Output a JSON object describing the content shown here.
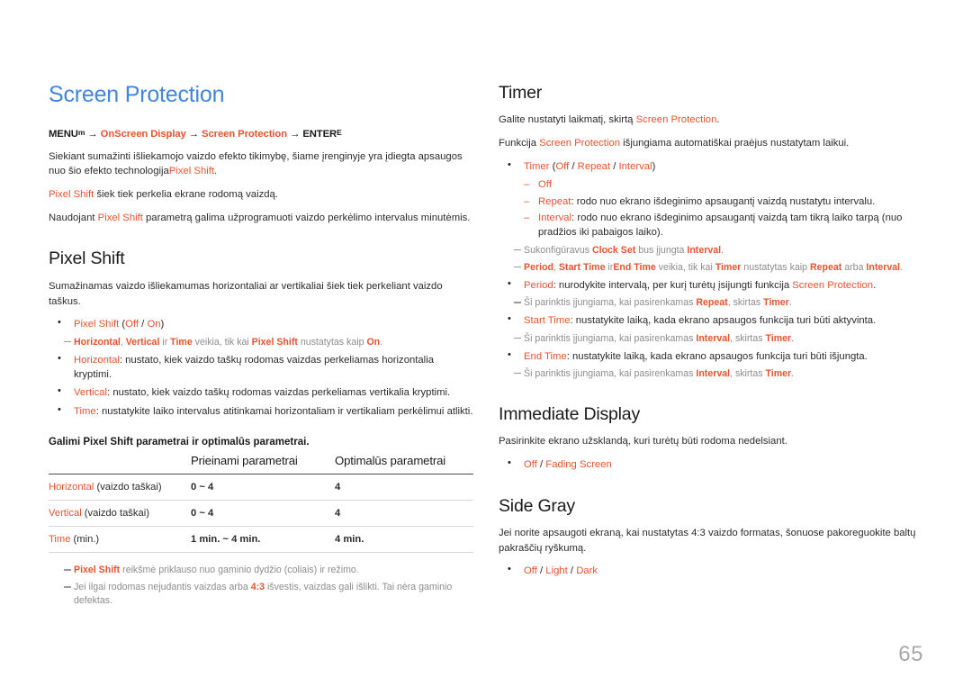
{
  "page": {
    "number": "65",
    "title": "Screen Protection",
    "title_color": "#4185dd",
    "accent_color": "#e8522e",
    "note_color": "#8c8c8c"
  },
  "left": {
    "menu_path": {
      "prefix": "MENU",
      "prefix_sup": "m",
      "arrow1": "→",
      "item1": "OnScreen Display",
      "arrow2": "→",
      "item2": "Screen Protection",
      "arrow3": "→",
      "suffix": "ENTER",
      "suffix_sup": "E"
    },
    "intro": [
      {
        "segments": [
          {
            "t": "Siekiant sumažinti išliekamojo vaizdo efekto tikimybę, šiame įrenginyje yra įdiegta apsaugos nuo šio efekto technologija",
            "s": "plain"
          },
          {
            "t": "Pixel Shift",
            "s": "orange"
          },
          {
            "t": ".",
            "s": "plain"
          }
        ]
      },
      {
        "segments": [
          {
            "t": "Pixel Shift",
            "s": "orange"
          },
          {
            "t": " šiek tiek perkelia ekrane rodomą vaizdą.",
            "s": "plain"
          }
        ]
      },
      {
        "segments": [
          {
            "t": "Naudojant ",
            "s": "plain"
          },
          {
            "t": "Pixel Shift",
            "s": "orange"
          },
          {
            "t": " parametrą galima užprogramuoti vaizdo perkėlimo intervalus minutėmis.",
            "s": "plain"
          }
        ]
      }
    ],
    "pixel_shift": {
      "heading": "Pixel Shift",
      "desc": "Sumažinamas vaizdo išliekamumas horizontaliai ar vertikaliai šiek tiek perkeliant vaizdo taškus.",
      "items": [
        {
          "type": "bullet",
          "segments": [
            {
              "t": "Pixel Shift",
              "s": "orange"
            },
            {
              "t": " (",
              "s": "plain"
            },
            {
              "t": "Off",
              "s": "orange"
            },
            {
              "t": " / ",
              "s": "plain"
            },
            {
              "t": "On",
              "s": "orange"
            },
            {
              "t": ")",
              "s": "plain"
            }
          ]
        },
        {
          "type": "note",
          "segments": [
            {
              "t": "Horizontal",
              "s": "orange-b"
            },
            {
              "t": ", ",
              "s": "gray"
            },
            {
              "t": "Vertical",
              "s": "orange-b"
            },
            {
              "t": " ir ",
              "s": "gray"
            },
            {
              "t": "Time",
              "s": "orange-b"
            },
            {
              "t": " veikia, tik kai ",
              "s": "gray"
            },
            {
              "t": "Pixel Shift",
              "s": "orange-b"
            },
            {
              "t": " nustatytas kaip ",
              "s": "gray"
            },
            {
              "t": "On",
              "s": "orange-b"
            },
            {
              "t": ".",
              "s": "gray"
            }
          ]
        },
        {
          "type": "bullet",
          "segments": [
            {
              "t": "Horizontal",
              "s": "orange"
            },
            {
              "t": ": nustato, kiek vaizdo taškų rodomas vaizdas perkeliamas horizontalia kryptimi.",
              "s": "plain"
            }
          ]
        },
        {
          "type": "bullet",
          "segments": [
            {
              "t": "Vertical",
              "s": "orange"
            },
            {
              "t": ": nustato, kiek vaizdo taškų rodomas vaizdas perkeliamas vertikalia kryptimi.",
              "s": "plain"
            }
          ]
        },
        {
          "type": "bullet",
          "segments": [
            {
              "t": "Time",
              "s": "orange"
            },
            {
              "t": ": nustatykite laiko intervalus atitinkamai horizontaliam ir vertikaliam perkėlimui atlikti.",
              "s": "plain"
            }
          ]
        }
      ]
    },
    "table": {
      "caption": "Galimi Pixel Shift parametrai ir optimalūs parametrai.",
      "headers": [
        "",
        "Prieinami parametrai",
        "Optimalūs parametrai"
      ],
      "rows": [
        {
          "label": "Horizontal",
          "label_suffix": " (vaizdo taškai)",
          "available": "0 ~ 4",
          "optimal": "4"
        },
        {
          "label": "Vertical",
          "label_suffix": " (vaizdo taškai)",
          "available": "0 ~ 4",
          "optimal": "4"
        },
        {
          "label": "Time",
          "label_suffix": " (min.)",
          "available": "1 min. ~ 4 min.",
          "optimal": "4 min."
        }
      ]
    },
    "table_notes": [
      {
        "segments": [
          {
            "t": "Pixel Shift",
            "s": "orange-b"
          },
          {
            "t": " reikšmė priklauso nuo gaminio dydžio (coliais) ir režimo.",
            "s": "gray"
          }
        ]
      },
      {
        "segments": [
          {
            "t": "Jei ilgai rodomas nejudantis vaizdas arba ",
            "s": "gray"
          },
          {
            "t": "4:3",
            "s": "orange-b"
          },
          {
            "t": " išvestis, vaizdas gali išlikti. Tai nėra gaminio defektas.",
            "s": "gray"
          }
        ]
      }
    ]
  },
  "right": {
    "timer": {
      "heading": "Timer",
      "paras": [
        {
          "segments": [
            {
              "t": "Galite nustatyti laikmatį, skirtą ",
              "s": "plain"
            },
            {
              "t": "Screen Protection",
              "s": "orange"
            },
            {
              "t": ".",
              "s": "plain"
            }
          ]
        },
        {
          "segments": [
            {
              "t": "Funkcija ",
              "s": "plain"
            },
            {
              "t": "Screen Protection",
              "s": "orange"
            },
            {
              "t": " išjungiama automatiškai praėjus nustatytam laikui.",
              "s": "plain"
            }
          ]
        }
      ],
      "items": [
        {
          "type": "bullet",
          "segments": [
            {
              "t": "Timer",
              "s": "orange"
            },
            {
              "t": " (",
              "s": "plain"
            },
            {
              "t": "Off",
              "s": "orange"
            },
            {
              "t": " / ",
              "s": "plain"
            },
            {
              "t": "Repeat",
              "s": "orange"
            },
            {
              "t": " / ",
              "s": "plain"
            },
            {
              "t": "Interval",
              "s": "orange"
            },
            {
              "t": ")",
              "s": "plain"
            }
          ]
        },
        {
          "type": "dash",
          "segments": [
            {
              "t": "Off",
              "s": "orange"
            }
          ]
        },
        {
          "type": "dash",
          "segments": [
            {
              "t": "Repeat",
              "s": "orange"
            },
            {
              "t": ": rodo nuo ekrano išdeginimo apsaugantį vaizdą nustatytu intervalu.",
              "s": "plain"
            }
          ]
        },
        {
          "type": "dash",
          "segments": [
            {
              "t": "Interval",
              "s": "orange"
            },
            {
              "t": ": rodo nuo ekrano išdeginimo apsaugantį vaizdą tam tikrą laiko tarpą (nuo pradžios iki pabaigos laiko).",
              "s": "plain"
            }
          ]
        },
        {
          "type": "note",
          "segments": [
            {
              "t": "Sukonfigūravus ",
              "s": "gray"
            },
            {
              "t": "Clock Set",
              "s": "orange-b"
            },
            {
              "t": " bus įjungta ",
              "s": "gray"
            },
            {
              "t": "Interval",
              "s": "orange-b"
            },
            {
              "t": ".",
              "s": "gray"
            }
          ]
        },
        {
          "type": "note",
          "segments": [
            {
              "t": "Period",
              "s": "orange-b"
            },
            {
              "t": ", ",
              "s": "gray"
            },
            {
              "t": "Start Time",
              "s": "orange-b"
            },
            {
              "t": " ir",
              "s": "gray"
            },
            {
              "t": "End Time",
              "s": "orange-b"
            },
            {
              "t": " veikia, tik kai ",
              "s": "gray"
            },
            {
              "t": "Timer",
              "s": "orange-b"
            },
            {
              "t": " nustatytas kaip ",
              "s": "gray"
            },
            {
              "t": "Repeat",
              "s": "orange-b"
            },
            {
              "t": " arba ",
              "s": "gray"
            },
            {
              "t": "Interval",
              "s": "orange-b"
            },
            {
              "t": ".",
              "s": "gray"
            }
          ]
        },
        {
          "type": "bullet",
          "segments": [
            {
              "t": "Period",
              "s": "orange"
            },
            {
              "t": ": nurodykite intervalą, per kurį turėtų įsijungti funkcija ",
              "s": "plain"
            },
            {
              "t": "Screen Protection",
              "s": "orange"
            },
            {
              "t": ".",
              "s": "plain"
            }
          ]
        },
        {
          "type": "note",
          "segments": [
            {
              "t": "Ši parinktis įjungiama, kai pasirenkamas ",
              "s": "gray"
            },
            {
              "t": "Repeat",
              "s": "orange-b"
            },
            {
              "t": ", skirtas ",
              "s": "gray"
            },
            {
              "t": "Timer",
              "s": "orange-b"
            },
            {
              "t": ".",
              "s": "gray"
            }
          ]
        },
        {
          "type": "bullet",
          "segments": [
            {
              "t": "Start Time",
              "s": "orange"
            },
            {
              "t": ": nustatykite laiką, kada ekrano apsaugos funkcija turi būti aktyvinta.",
              "s": "plain"
            }
          ]
        },
        {
          "type": "note",
          "segments": [
            {
              "t": "Ši parinktis įjungiama, kai pasirenkamas ",
              "s": "gray"
            },
            {
              "t": "Interval",
              "s": "orange-b"
            },
            {
              "t": ", skirtas ",
              "s": "gray"
            },
            {
              "t": "Timer",
              "s": "orange-b"
            },
            {
              "t": ".",
              "s": "gray"
            }
          ]
        },
        {
          "type": "bullet",
          "segments": [
            {
              "t": "End Time",
              "s": "orange"
            },
            {
              "t": ": nustatykite laiką, kada ekrano apsaugos funkcija turi būti išjungta.",
              "s": "plain"
            }
          ]
        },
        {
          "type": "note",
          "segments": [
            {
              "t": "Ši parinktis įjungiama, kai pasirenkamas ",
              "s": "gray"
            },
            {
              "t": "Interval",
              "s": "orange-b"
            },
            {
              "t": ", skirtas ",
              "s": "gray"
            },
            {
              "t": "Timer",
              "s": "orange-b"
            },
            {
              "t": ".",
              "s": "gray"
            }
          ]
        }
      ]
    },
    "immediate_display": {
      "heading": "Immediate Display",
      "desc": "Pasirinkite ekrano užsklandą, kuri turėtų būti rodoma nedelsiant.",
      "items": [
        {
          "type": "bullet",
          "segments": [
            {
              "t": "Off",
              "s": "orange"
            },
            {
              "t": " / ",
              "s": "plain"
            },
            {
              "t": "Fading Screen",
              "s": "orange"
            }
          ]
        }
      ]
    },
    "side_gray": {
      "heading": "Side Gray",
      "desc": "Jei norite apsaugoti ekraną, kai nustatytas 4:3 vaizdo formatas, šonuose pakoreguokite baltų pakraščių ryškumą.",
      "items": [
        {
          "type": "bullet",
          "segments": [
            {
              "t": "Off",
              "s": "orange"
            },
            {
              "t": " / ",
              "s": "plain"
            },
            {
              "t": "Light",
              "s": "orange"
            },
            {
              "t": " / ",
              "s": "plain"
            },
            {
              "t": "Dark",
              "s": "orange"
            }
          ]
        }
      ]
    }
  }
}
